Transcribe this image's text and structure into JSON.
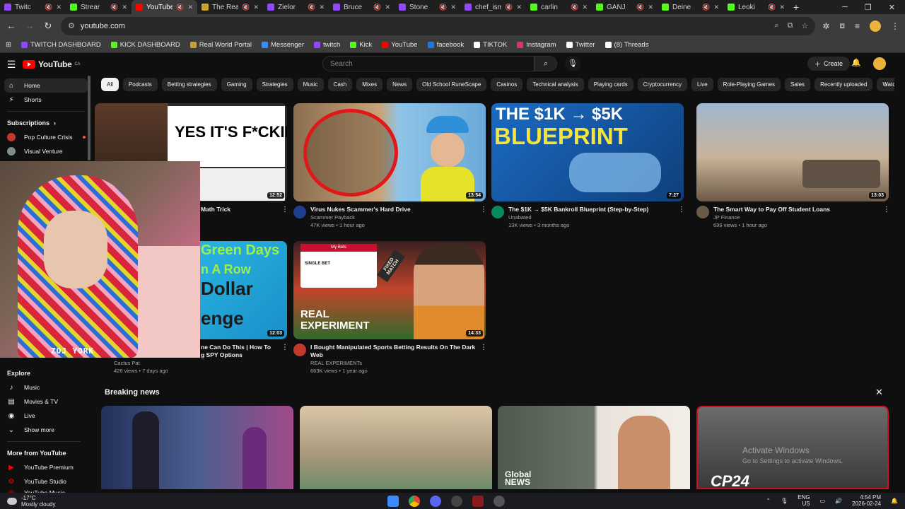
{
  "browser": {
    "tabs": [
      {
        "label": "Twitc",
        "color": "#9146ff"
      },
      {
        "label": "Strear",
        "color": "#53fc18"
      },
      {
        "label": "YouTube",
        "color": "#ff0000",
        "active": true
      },
      {
        "label": "The Real",
        "color": "#c9a227"
      },
      {
        "label": "Zielor",
        "color": "#9146ff"
      },
      {
        "label": "Bruce",
        "color": "#9146ff"
      },
      {
        "label": "Stone",
        "color": "#9146ff"
      },
      {
        "label": "chef_ism",
        "color": "#9146ff"
      },
      {
        "label": "carlin",
        "color": "#53fc18"
      },
      {
        "label": "GANJ",
        "color": "#53fc18"
      },
      {
        "label": "Deine",
        "color": "#53fc18"
      },
      {
        "label": "Leoki",
        "color": "#53fc18"
      }
    ],
    "new_tab": "+",
    "url": "youtube.com",
    "bookmarks": [
      {
        "label": "TWITCH DASHBOARD",
        "color": "#9146ff"
      },
      {
        "label": "KICK DASHBOARD",
        "color": "#53fc18"
      },
      {
        "label": "Real World Portal",
        "color": "#c9a227"
      },
      {
        "label": "Messenger",
        "color": "#3a8bff"
      },
      {
        "label": "twitch",
        "color": "#9146ff"
      },
      {
        "label": "Kick",
        "color": "#53fc18"
      },
      {
        "label": "YouTube",
        "color": "#ff0000"
      },
      {
        "label": "facebook",
        "color": "#1877f2"
      },
      {
        "label": "TIKTOK",
        "color": "#ffffff"
      },
      {
        "label": "Instagram",
        "color": "#e1306c"
      },
      {
        "label": "Twitter",
        "color": "#ffffff"
      },
      {
        "label": "(8) Threads",
        "color": "#ffffff"
      }
    ]
  },
  "youtube": {
    "logo": "YouTube",
    "logo_region": "CA",
    "search_placeholder": "Search",
    "create_label": "Create"
  },
  "sidebar": {
    "home": "Home",
    "shorts": "Shorts",
    "subscriptions": "Subscriptions",
    "subs": [
      {
        "name": "Pop Culture Crisis",
        "color": "#c0392b"
      },
      {
        "name": "Visual Venture",
        "color": "#7f8c8d"
      }
    ],
    "explore": "Explore",
    "explore_items": [
      "Music",
      "Movies & TV",
      "Live",
      "Show more"
    ],
    "more_from": "More from YouTube",
    "more_items": [
      "YouTube Premium",
      "YouTube Studio",
      "YouTube Music"
    ]
  },
  "chips": [
    "All",
    "Podcasts",
    "Betting strategies",
    "Gaming",
    "Strategies",
    "Music",
    "Cash",
    "Mixes",
    "News",
    "Old School RuneScape",
    "Casinos",
    "Technical analysis",
    "Playing cards",
    "Cryptocurrency",
    "Live",
    "Role-Playing Games",
    "Sales",
    "Recently uploaded",
    "Watched"
  ],
  "videos": [
    {
      "title": "Math Trick",
      "channel": "",
      "stats": "",
      "duration": "12:52",
      "thumb_text": "YES IT'S F*CKING EASY",
      "accent": "#ffffff"
    },
    {
      "title": "Virus Nukes Scammer's Hard Drive",
      "channel": "Scammer Payback",
      "stats": "47K views • 1 hour ago",
      "duration": "13:54",
      "accent": "#2f8fd8"
    },
    {
      "title": "The $1K → $5K Bankroll Blueprint (Step-by-Step)",
      "channel": "Unabated",
      "stats": "13K views • 3 months ago",
      "duration": "7:27",
      "thumb_text_1": "THE $1K",
      "thumb_text_arrow": "→",
      "thumb_text_2": "$5K",
      "thumb_text_3": "BLUEPRINT",
      "accent": "#1a64b8"
    },
    {
      "title": "The Smart Way to Pay Off Student Loans",
      "channel": "JP Finance",
      "stats": "699 views • 1 hour ago",
      "duration": "13:03",
      "accent": "#b8c4d6"
    },
    {
      "title": "ne Can Do This | How To",
      "title_2": "g SPY Options",
      "channel": "Cactus Pat",
      "stats": "426 views • 7 days ago",
      "duration": "12:03",
      "thumb_text_1": "Green Days",
      "thumb_text_2": "n A Row",
      "thumb_text_3": "Dollar",
      "thumb_text_4": "enge",
      "accent": "#2bb5e0"
    },
    {
      "title": "I Bought Manipulated Sports Betting Results On The Dark Web",
      "channel": "REAL EXPERIMENTs",
      "stats": "663K views • 1 year ago",
      "duration": "14:33",
      "thumb_text": "REAL EXPERIMENT",
      "thumb_card": "My Bets",
      "thumb_bet": "SINGLE BET",
      "thumb_stamp": "FIXED MATCH",
      "accent": "#c0392b"
    }
  ],
  "breaking_news": {
    "title": "Breaking news",
    "close": "×",
    "items": [
      {
        "caption": "",
        "accent": "#3b4a6b"
      },
      {
        "caption": "",
        "accent": "#c8b79a"
      },
      {
        "caption": "Global NEWS",
        "accent": "#5b6a5a"
      },
      {
        "caption": "CP24",
        "accent": "#5a5a5a"
      }
    ]
  },
  "overlay": {
    "webcam_name": "ZOJ YORK",
    "activate_title": "Activate Windows",
    "activate_sub": "Go to Settings to activate Windows."
  },
  "taskbar": {
    "temp": "-17°C",
    "weather": "Mostly cloudy",
    "lang_1": "ENG",
    "lang_2": "US",
    "time": "4:54 PM",
    "date": "2026-02-24"
  }
}
